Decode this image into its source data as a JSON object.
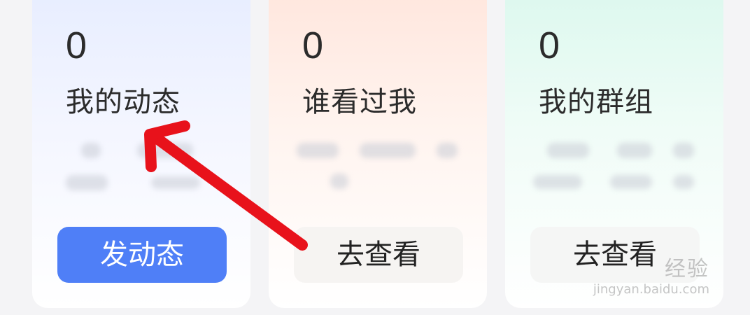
{
  "cards": [
    {
      "count": "0",
      "title": "我的动态",
      "button": "发动态"
    },
    {
      "count": "0",
      "title": "谁看过我",
      "button": "去查看"
    },
    {
      "count": "0",
      "title": "我的群组",
      "button": "去查看"
    }
  ],
  "accent_colors": {
    "primary_button": "#4f7ff7",
    "annotation_arrow": "#e8121b"
  },
  "watermark": {
    "main": "经验",
    "url": "jingyan.baidu.com"
  }
}
